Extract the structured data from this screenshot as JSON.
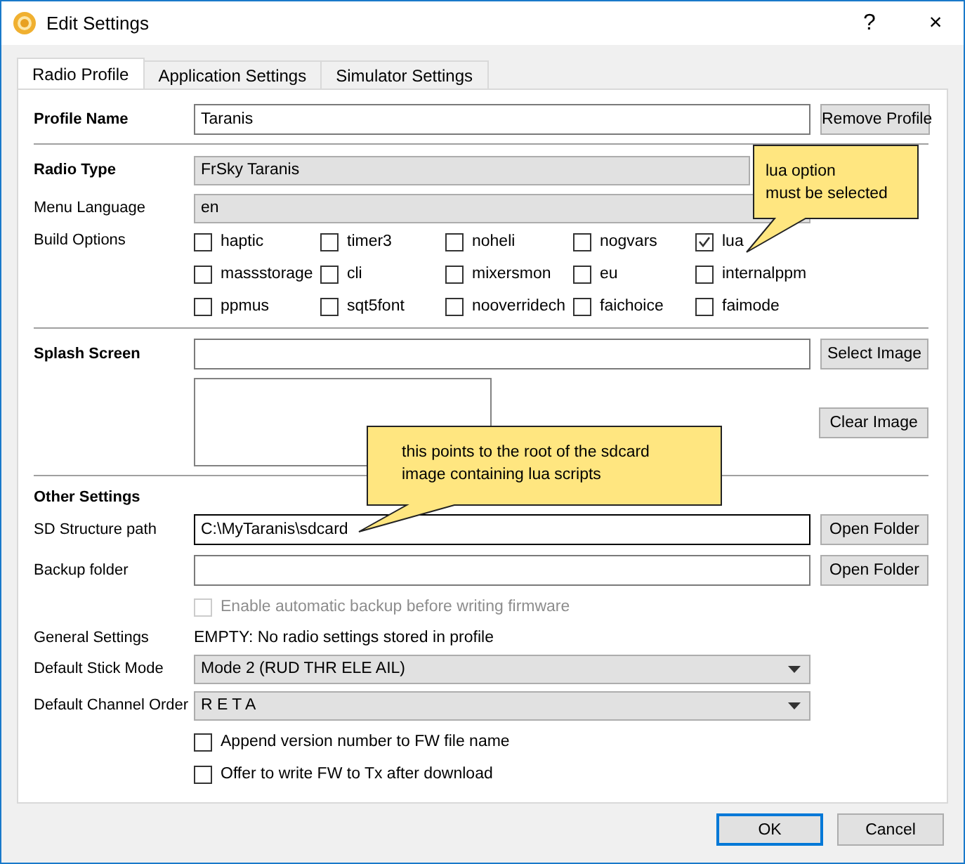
{
  "window": {
    "title": "Edit Settings",
    "help": "?",
    "close": "×"
  },
  "tabs": [
    {
      "label": "Radio Profile",
      "selected": true
    },
    {
      "label": "Application Settings",
      "selected": false
    },
    {
      "label": "Simulator Settings",
      "selected": false
    }
  ],
  "profile_name": {
    "label": "Profile Name",
    "value": "Taranis",
    "button": "Remove Profile"
  },
  "radio_type": {
    "label": "Radio Type",
    "value": "FrSky Taranis"
  },
  "menu_language": {
    "label": "Menu Language",
    "value": "en"
  },
  "build_options": {
    "label": "Build Options",
    "options": [
      {
        "label": "haptic",
        "checked": false
      },
      {
        "label": "timer3",
        "checked": false
      },
      {
        "label": "noheli",
        "checked": false
      },
      {
        "label": "nogvars",
        "checked": false
      },
      {
        "label": "lua",
        "checked": true
      },
      {
        "label": "massstorage",
        "checked": false
      },
      {
        "label": "cli",
        "checked": false
      },
      {
        "label": "mixersmon",
        "checked": false
      },
      {
        "label": "eu",
        "checked": false
      },
      {
        "label": "internalppm",
        "checked": false
      },
      {
        "label": "ppmus",
        "checked": false
      },
      {
        "label": "sqt5font",
        "checked": false
      },
      {
        "label": "nooverridech",
        "checked": false
      },
      {
        "label": "faichoice",
        "checked": false
      },
      {
        "label": "faimode",
        "checked": false
      }
    ]
  },
  "splash_screen": {
    "label": "Splash Screen",
    "select_button": "Select Image",
    "clear_button": "Clear Image"
  },
  "other_settings": {
    "heading": "Other Settings",
    "sd_path": {
      "label": "SD Structure path",
      "value": "C:\\MyTaranis\\sdcard",
      "button": "Open Folder"
    },
    "backup_folder": {
      "label": "Backup folder",
      "button": "Open Folder"
    },
    "auto_backup": {
      "label": "Enable automatic backup before writing firmware",
      "checked": false,
      "disabled": true
    },
    "general_settings": {
      "label": "General Settings",
      "value": "EMPTY: No radio settings stored in profile"
    },
    "stick_mode": {
      "label": "Default Stick Mode",
      "value": "Mode 2 (RUD THR ELE AIL)"
    },
    "channel_order": {
      "label": "Default Channel Order",
      "value": "R E T A"
    },
    "options": [
      {
        "label": "Append version number to FW file name",
        "checked": false,
        "disabled": false
      },
      {
        "label": "Offer to write FW to Tx after download",
        "checked": false,
        "disabled": false
      }
    ]
  },
  "callouts": [
    {
      "text": "lua option\nmust be selected"
    },
    {
      "text": "this points to the root of the sdcard\nimage containing lua scripts"
    }
  ],
  "buttons": [
    {
      "label": "OK",
      "default": true
    },
    {
      "label": "Cancel",
      "default": false
    }
  ]
}
